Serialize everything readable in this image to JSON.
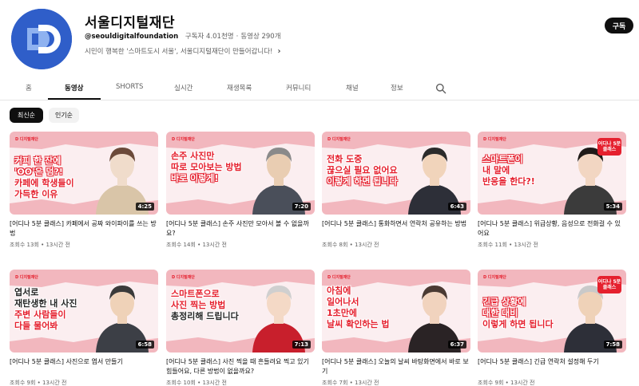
{
  "channel": {
    "title": "서울디지털재단",
    "handle": "@seouldigitalfoundation",
    "subscribers": "구독자 4.01천명",
    "video_count": "동영상 290개",
    "description": "시민이 행복한 '스마트도시 서울', 서울디지털재단이 만들어갑니다!",
    "subscribe_label": "구독",
    "brand_color": "#2f5ec9"
  },
  "tabs": [
    "홈",
    "동영상",
    "SHORTS",
    "실시간",
    "재생목록",
    "커뮤니티",
    "채널",
    "정보"
  ],
  "active_tab": "동영상",
  "chips": {
    "latest": "최신순",
    "popular": "인기순"
  },
  "thumb_brand": "디지털재단",
  "badge_text": "어디나\n5분\n클래스",
  "videos": [
    {
      "captions": [
        "커피 한 잔에",
        "'OO'은 덤?!",
        "카페에 학생들이",
        "가득한 이유"
      ],
      "duration": "4:25",
      "title": "[어디나 5분 클래스] 카페에서 공짜 와이파이를 쓰는 방법",
      "views": "조회수 13회",
      "age": "13시간 전"
    },
    {
      "captions": [
        "손주 사진만",
        "따로 모아보는 방법",
        "바로 이렇게!"
      ],
      "duration": "7:20",
      "title": "[어디나 5분 클래스] 손주 사진만 모아서 볼 수 없을까요?",
      "views": "조회수 14회",
      "age": "13시간 전"
    },
    {
      "captions": [
        "전화 도중",
        "끊으실 필요 없어요",
        "이렇게 하면 됩니다"
      ],
      "duration": "6:43",
      "title": "[어디나 5분 클래스] 통화하면서 연락처 공유하는 방법",
      "views": "조회수 8회",
      "age": "13시간 전"
    },
    {
      "captions": [
        "스마트폰이",
        "내 말에",
        "반응을 한다?!"
      ],
      "duration": "5:34",
      "title": "[어디나 5분 클래스] 위급상황, 음성으로 전화걸 수 있어요",
      "views": "조회수 11회",
      "age": "13시간 전"
    },
    {
      "captions": [
        "엽서로",
        "재탄생한 내 사진",
        "주변 사람들이",
        "다들 물어봐"
      ],
      "duration": "6:58",
      "title": "[어디나 5분 클래스] 사진으로 엽서 만들기",
      "views": "조회수 9회",
      "age": "13시간 전"
    },
    {
      "captions": [
        "스마트폰으로",
        "사진 찍는 방법",
        "총정리해 드립니다"
      ],
      "duration": "7:13",
      "title": "[어디나 5분 클래스] 사진 찍을 때 흔들려요 찍고 있기 힘들어요, 다른 방법이 없을까요?",
      "views": "조회수 10회",
      "age": "13시간 전"
    },
    {
      "captions": [
        "아침에",
        "일어나서",
        "1초만에",
        "날씨 확인하는 법"
      ],
      "duration": "6:37",
      "title": "[어디나 5분 클래스] 오늘의 날씨 바탕화면에서 바로 보기",
      "views": "조회수 7회",
      "age": "13시간 전"
    },
    {
      "captions": [
        "긴급 상황에",
        "대한 대비",
        "이렇게 하면 됩니다"
      ],
      "duration": "7:58",
      "title": "[어디나 5분 클래스] 긴급 연락처 설정해 두기",
      "views": "조회수 9회",
      "age": "13시간 전"
    }
  ]
}
